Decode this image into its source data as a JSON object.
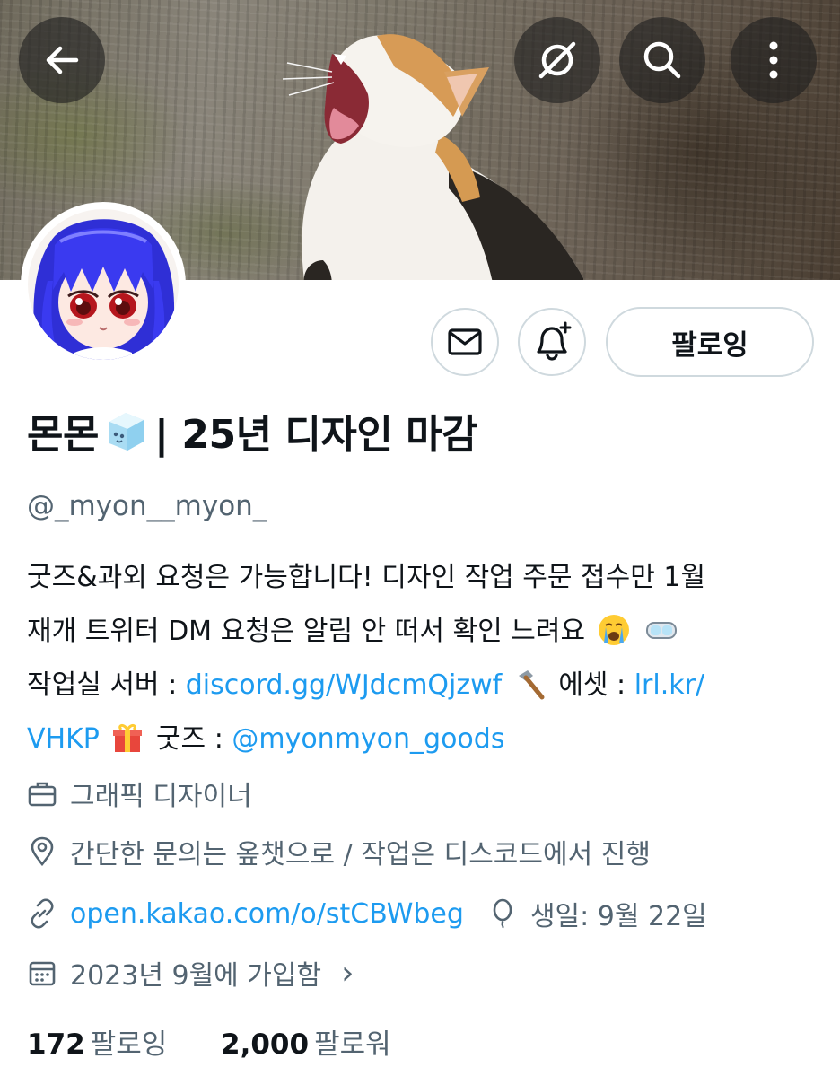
{
  "header": {
    "back_icon": "arrow-left-icon",
    "grok_icon": "grok-icon",
    "search_icon": "search-icon",
    "more_icon": "more-vertical-icon"
  },
  "actions": {
    "message_icon": "mail-icon",
    "notify_icon": "bell-plus-icon",
    "follow_label": "팔로잉"
  },
  "profile": {
    "name_before": "몬몬",
    "name_emoji": "ice-cube-emoji",
    "name_after": "| 25년 디자인 마감",
    "handle": "@_myon__myon_"
  },
  "bio": {
    "line1": "굿즈&과외 요청은 가능합니다! 디자인 작업 주문 접수만 1월",
    "line2": "재개 트위터 DM 요청은 알림 안 떠서 확인 느려요",
    "line3_prefix": "작업실 서버 : ",
    "discord_link": "discord.gg/WJdcmQjzwf",
    "line3_mid": "에셋 : ",
    "asset_link_part1": "lrl.kr/",
    "asset_link_part2": "VHKP",
    "line4_mid": "굿즈 : ",
    "goods_mention": "@myonmyon_goods"
  },
  "meta": {
    "category": "그래픽 디자이너",
    "location": "간단한 문의는 옾챗으로 / 작업은 디스코드에서 진행",
    "website": "open.kakao.com/o/stCBWbeg",
    "birthday": "생일: 9월 22일",
    "joined": "2023년 9월에 가입함",
    "joined_chevron": "›"
  },
  "stats": {
    "following_count": "172",
    "following_label": "팔로잉",
    "followers_count": "2,000",
    "followers_label": "팔로워"
  },
  "colors": {
    "link": "#1d9bf0",
    "secondary_text": "#536471",
    "primary_text": "#0f1419",
    "border": "#cfd9de"
  }
}
